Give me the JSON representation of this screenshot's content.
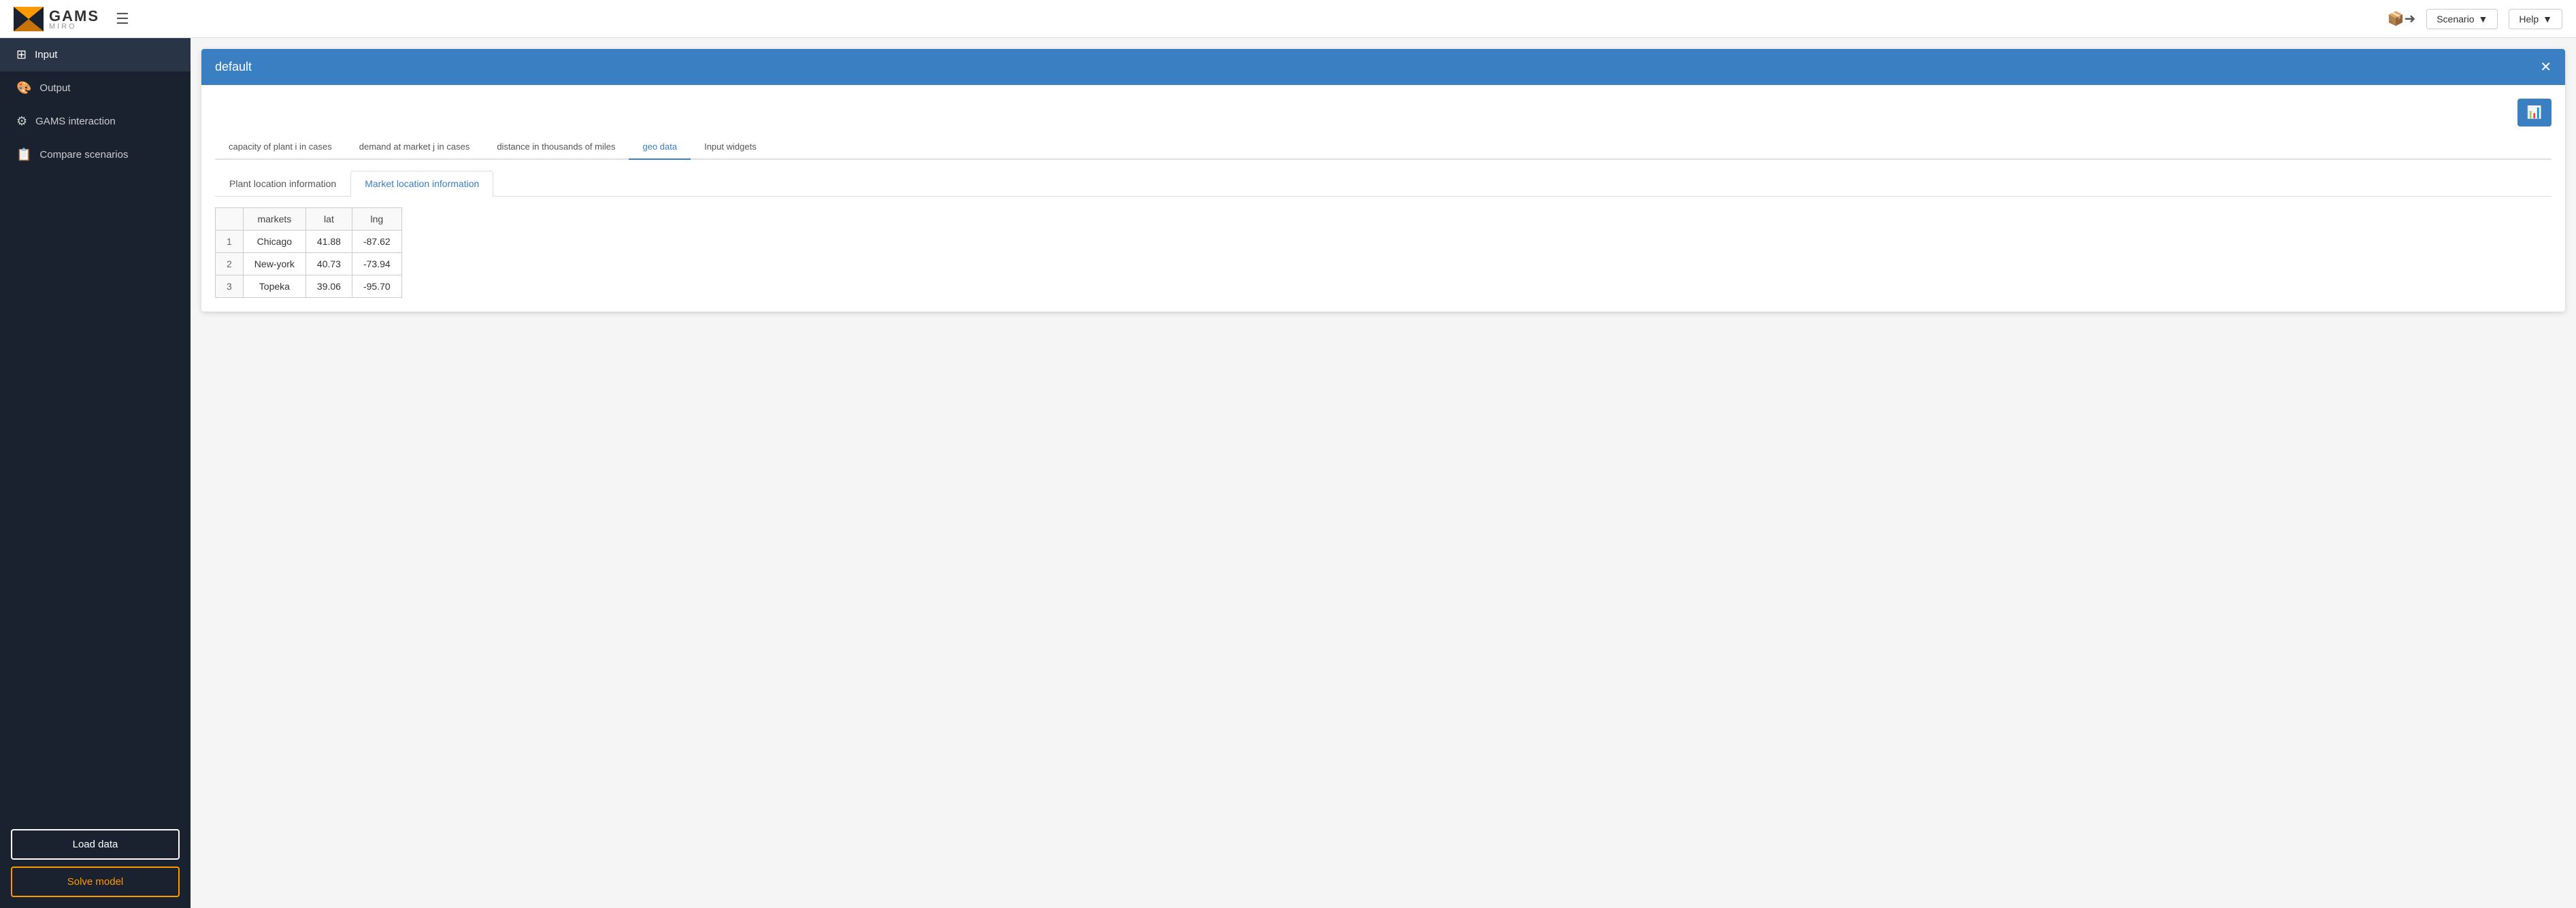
{
  "logo": {
    "brand": "GAMS",
    "sub": "MIRO"
  },
  "topbar": {
    "scenario_label": "Scenario",
    "help_label": "Help"
  },
  "sidebar": {
    "items": [
      {
        "id": "input",
        "label": "Input",
        "icon": "⊞",
        "active": true
      },
      {
        "id": "output",
        "label": "Output",
        "icon": "🎨"
      },
      {
        "id": "gams-interaction",
        "label": "GAMS interaction",
        "icon": "⚙"
      },
      {
        "id": "compare-scenarios",
        "label": "Compare scenarios",
        "icon": "📋"
      }
    ],
    "load_data_label": "Load data",
    "solve_model_label": "Solve model"
  },
  "panel": {
    "title": "default",
    "close_label": "✕"
  },
  "top_tabs": [
    {
      "id": "capacity",
      "label": "capacity of plant i in cases",
      "active": false
    },
    {
      "id": "demand",
      "label": "demand at market j in cases",
      "active": false
    },
    {
      "id": "distance",
      "label": "distance in thousands of miles",
      "active": false
    },
    {
      "id": "geo",
      "label": "geo data",
      "active": true
    },
    {
      "id": "widgets",
      "label": "Input widgets",
      "active": false
    }
  ],
  "sub_tabs": [
    {
      "id": "plant",
      "label": "Plant location information",
      "active": false
    },
    {
      "id": "market",
      "label": "Market location information",
      "active": true
    }
  ],
  "table": {
    "headers": [
      "",
      "markets",
      "lat",
      "lng"
    ],
    "rows": [
      {
        "row_num": "1",
        "markets": "Chicago",
        "lat": "41.88",
        "lng": "-87.62"
      },
      {
        "row_num": "2",
        "markets": "New-york",
        "lat": "40.73",
        "lng": "-73.94"
      },
      {
        "row_num": "3",
        "markets": "Topeka",
        "lat": "39.06",
        "lng": "-95.70"
      }
    ]
  },
  "chart_btn_icon": "📊"
}
